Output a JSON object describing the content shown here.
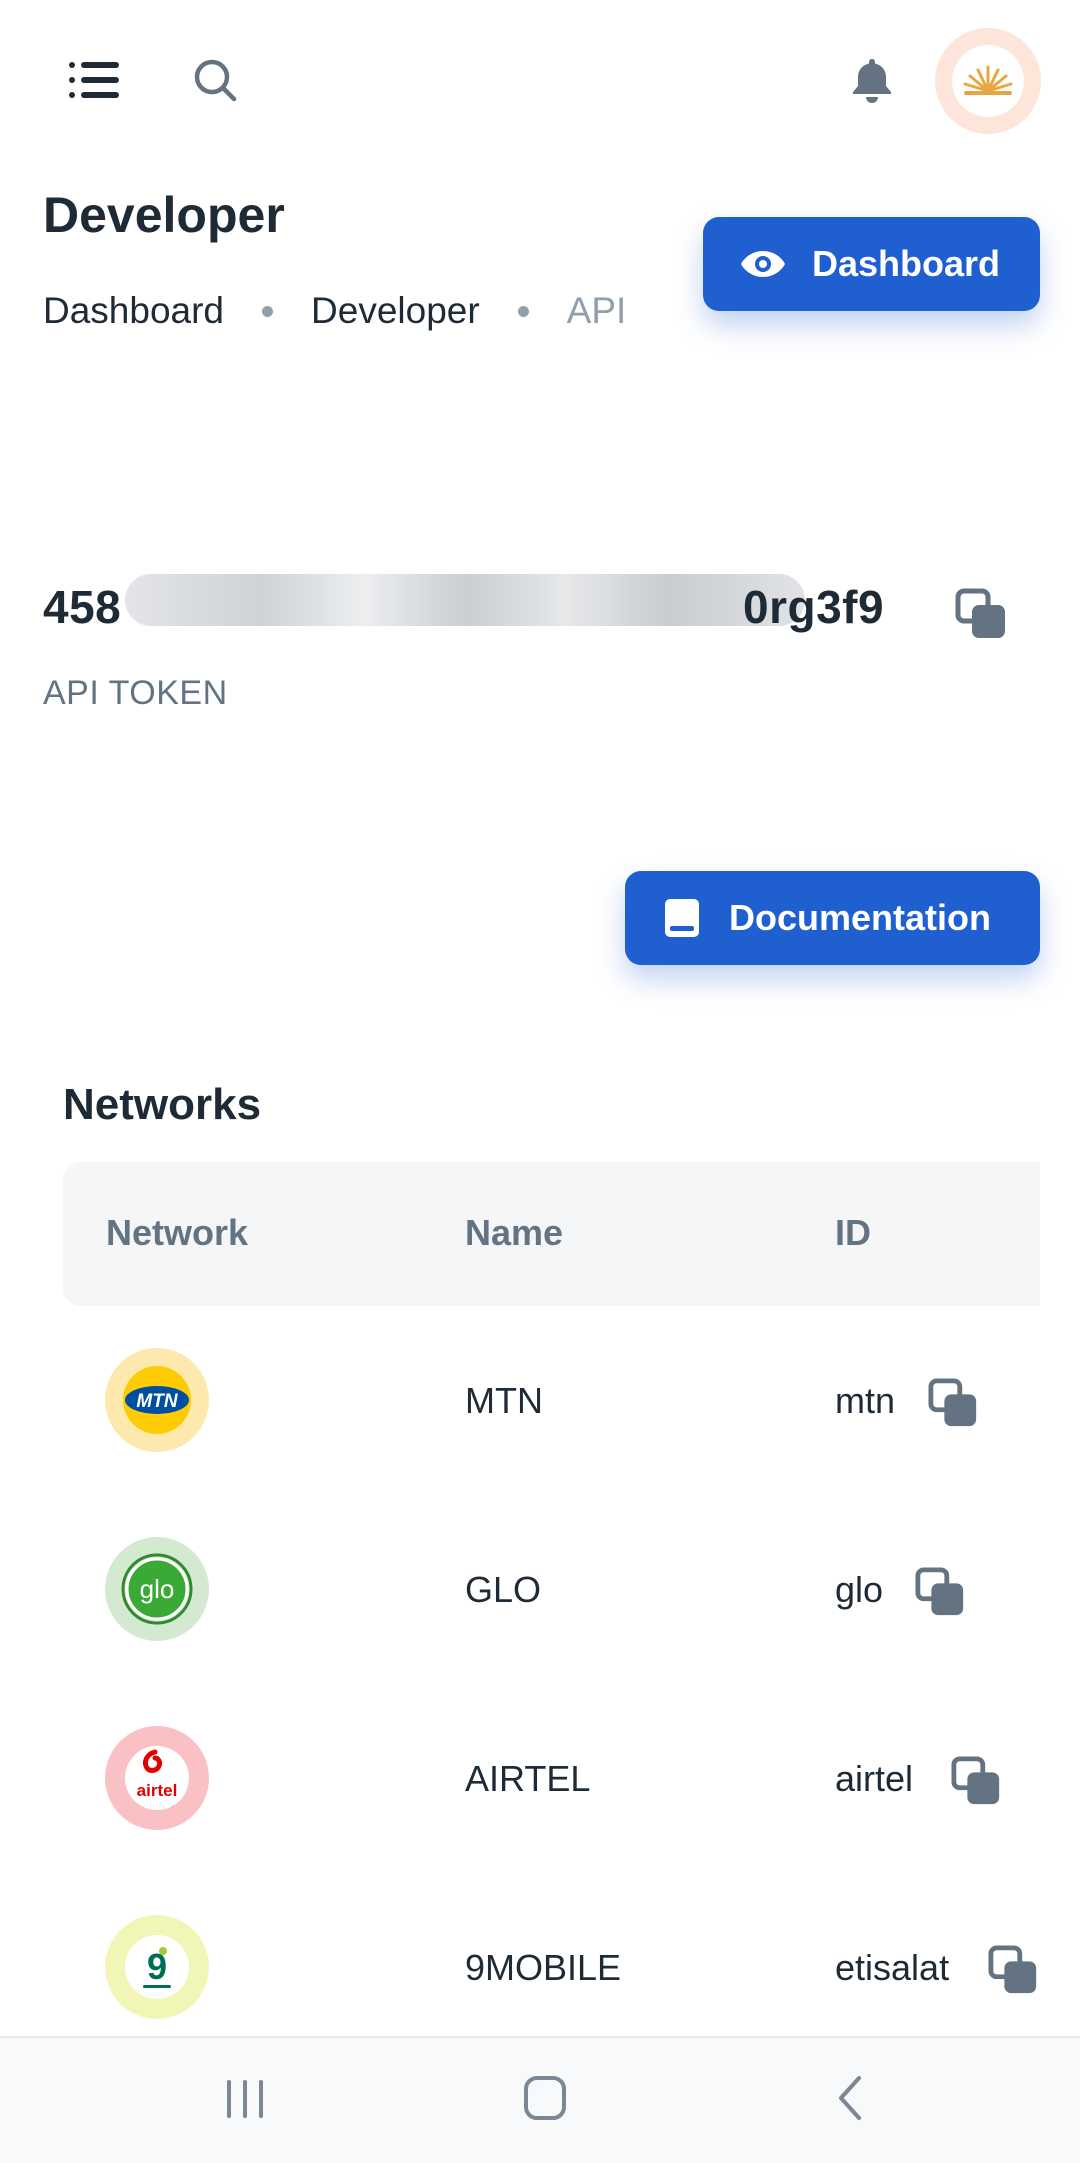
{
  "header": {
    "menu_icon": "menu-icon",
    "search_icon": "search-icon",
    "bell_icon": "bell-icon",
    "avatar": "avatar"
  },
  "page": {
    "title": "Developer",
    "breadcrumb": [
      "Dashboard",
      "Developer",
      "API"
    ],
    "dashboard_button": "Dashboard"
  },
  "api": {
    "token_start": "458",
    "token_end": "0rg3f9",
    "token_label": "API TOKEN",
    "documentation_button": "Documentation"
  },
  "networks": {
    "title": "Networks",
    "columns": [
      "Network",
      "Name",
      "ID"
    ],
    "rows": [
      {
        "logo": "MTN",
        "name": "MTN",
        "id": "mtn",
        "color": "#ffcb05"
      },
      {
        "logo": "glo",
        "name": "GLO",
        "id": "glo",
        "color": "#3aa935"
      },
      {
        "logo": "airtel",
        "name": "AIRTEL",
        "id": "airtel",
        "color": "#e40000"
      },
      {
        "logo": "9",
        "name": "9MOBILE",
        "id": "etisalat",
        "color": "#006e53"
      }
    ]
  },
  "colors": {
    "primary": "#1f5fd0",
    "text": "#1f2a37",
    "muted": "#919eab"
  }
}
